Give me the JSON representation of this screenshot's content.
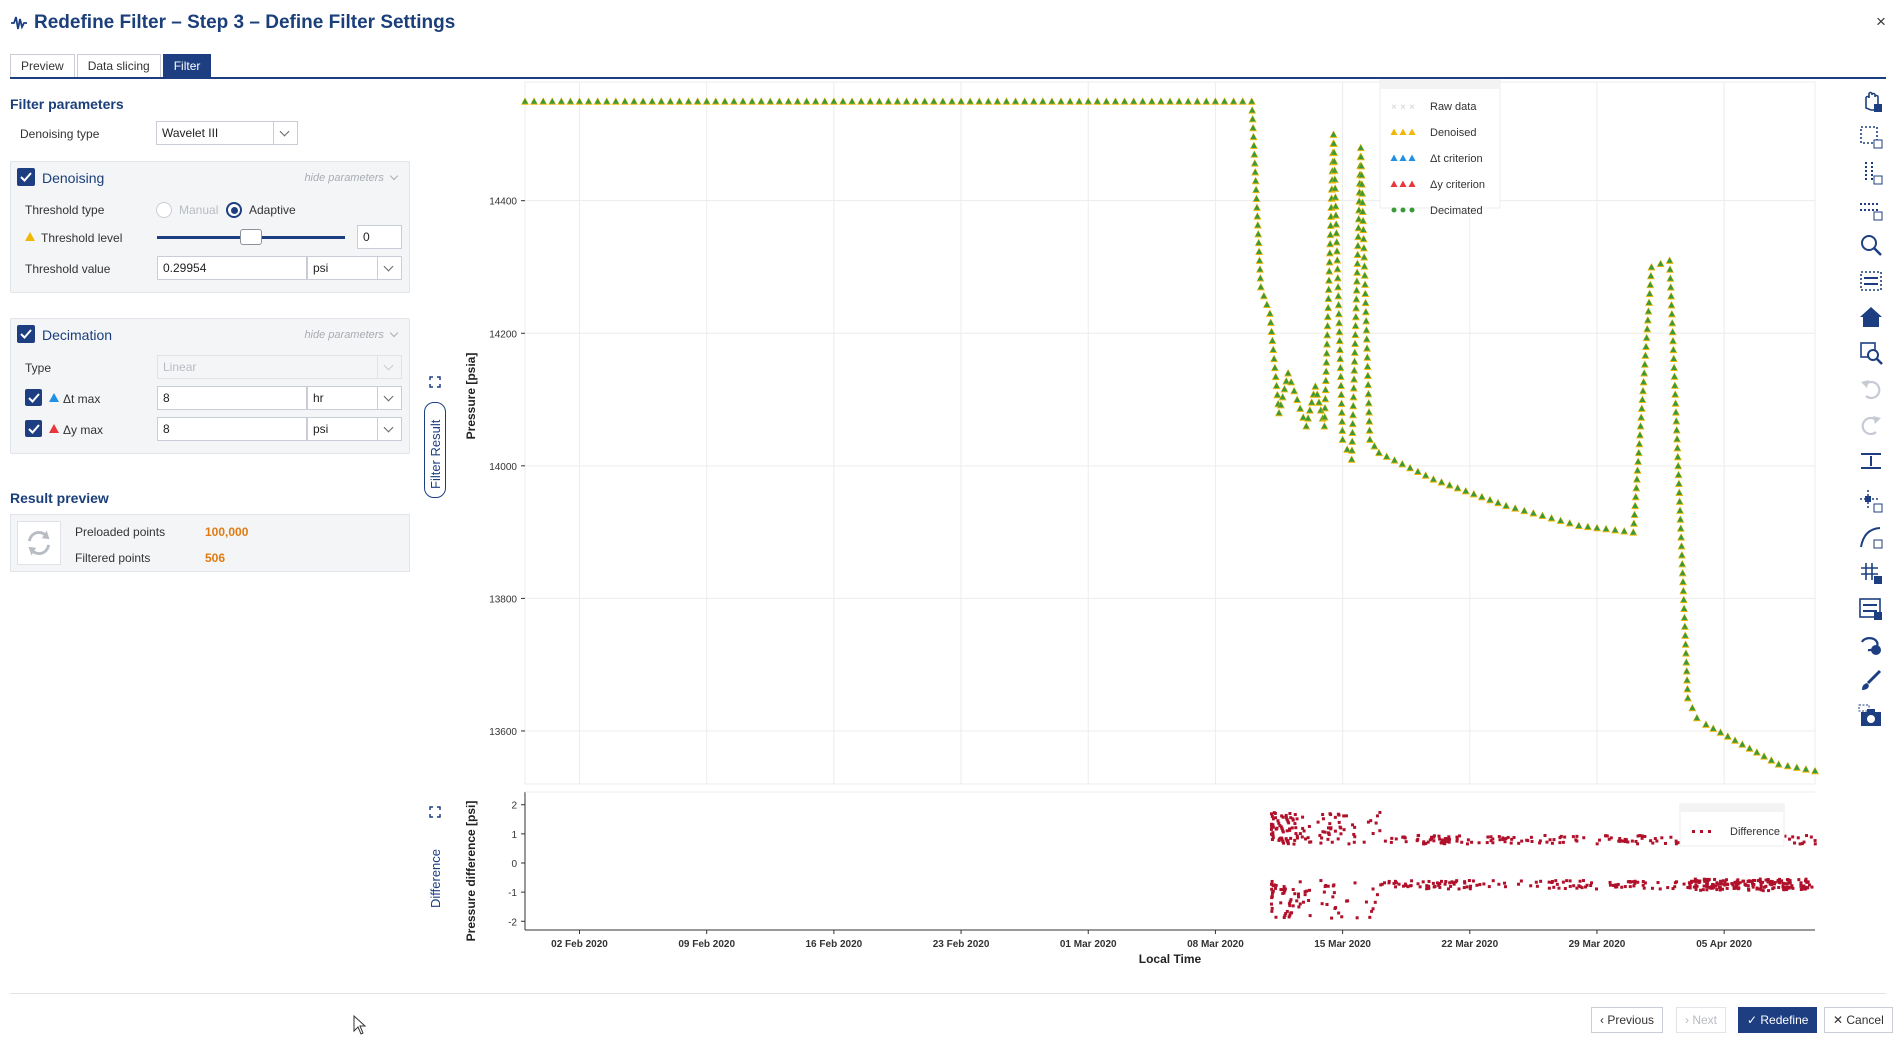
{
  "window": {
    "title": "Redefine Filter – Step 3 – Define Filter Settings",
    "close_label": "×"
  },
  "tabs": [
    {
      "label": "Preview",
      "active": false
    },
    {
      "label": "Data slicing",
      "active": false
    },
    {
      "label": "Filter",
      "active": true
    }
  ],
  "filter_params": {
    "title": "Filter parameters",
    "denoising_type_label": "Denoising type",
    "denoising_type_value": "Wavelet III"
  },
  "denoising": {
    "title": "Denoising",
    "checked": true,
    "hide_params": "hide parameters",
    "threshold_type_label": "Threshold type",
    "manual_label": "Manual",
    "adaptive_label": "Adaptive",
    "selected": "Adaptive",
    "threshold_level_label": "Threshold level",
    "threshold_level_value": "0",
    "threshold_level_position": 0.5,
    "threshold_value_label": "Threshold value",
    "threshold_value": "0.29954",
    "threshold_unit": "psi"
  },
  "decimation": {
    "title": "Decimation",
    "checked": true,
    "hide_params": "hide parameters",
    "type_label": "Type",
    "type_value": "Linear",
    "dt_label": "Δt max",
    "dt_value": "8",
    "dt_unit": "hr",
    "dy_label": "Δy max",
    "dy_value": "8",
    "dy_unit": "psi"
  },
  "result_preview": {
    "title": "Result preview",
    "preloaded_label": "Preloaded points",
    "preloaded_value": "100,000",
    "filtered_label": "Filtered points",
    "filtered_value": "506"
  },
  "colors": {
    "accent": "#1d3f82",
    "denoised": "#f2b705",
    "dt": "#1e90e8",
    "dy": "#e8373c",
    "decimated": "#3a9a3a",
    "difference": "#b0102a",
    "orange": "#e07b12"
  },
  "chart_panels": {
    "main_tab_label": "Filter Result",
    "diff_tab_label": "Difference"
  },
  "chart_data": [
    {
      "type": "scatter",
      "title": "",
      "ylabel": "Pressure [psia]",
      "xlabel": "Local Time",
      "x_ticks": [
        "02 Feb 2020",
        "09 Feb 2020",
        "16 Feb 2020",
        "23 Feb 2020",
        "01 Mar 2020",
        "08 Mar 2020",
        "15 Mar 2020",
        "22 Mar 2020",
        "29 Mar 2020",
        "05 Apr 2020"
      ],
      "y_ticks": [
        13600,
        13800,
        14000,
        14200,
        14400
      ],
      "ylim": [
        13520,
        14570
      ],
      "xlim": [
        "2020-01-30",
        "2020-04-10"
      ],
      "grid": true,
      "legend": [
        "Raw data",
        "Denoised",
        "Δt criterion",
        "Δy criterion",
        "Decimated"
      ],
      "legend_position": "top-right",
      "series": [
        {
          "name": "Decimated",
          "x": [
            "2020-01-30",
            "2020-02-05",
            "2020-02-12",
            "2020-02-19",
            "2020-02-26",
            "2020-03-04",
            "2020-03-10",
            "2020-03-10.5",
            "2020-03-11",
            "2020-03-11.5",
            "2020-03-12",
            "2020-03-13",
            "2020-03-13.5",
            "2020-03-14",
            "2020-03-14.5",
            "2020-03-15",
            "2020-03-15.5",
            "2020-03-16",
            "2020-03-16.5",
            "2020-03-17",
            "2020-03-20",
            "2020-03-24",
            "2020-03-28",
            "2020-03-31",
            "2020-04-01",
            "2020-04-02",
            "2020-04-03",
            "2020-04-03.5",
            "2020-04-04",
            "2020-04-06",
            "2020-04-08",
            "2020-04-10"
          ],
          "y": [
            14550,
            14550,
            14550,
            14550,
            14550,
            14550,
            14550,
            14270,
            14230,
            14080,
            14140,
            14060,
            14120,
            14060,
            14500,
            14040,
            14010,
            14480,
            14040,
            14020,
            13980,
            13940,
            13910,
            13900,
            14300,
            14310,
            13650,
            13620,
            13610,
            13580,
            13550,
            13540
          ]
        }
      ]
    },
    {
      "type": "scatter",
      "ylabel": "Pressure difference [psi]",
      "xlabel": "Local Time",
      "y_ticks": [
        -2,
        -1,
        0,
        1,
        2
      ],
      "ylim": [
        -2.3,
        2.3
      ],
      "legend": [
        "Difference"
      ],
      "legend_position": "top-right",
      "series": [
        {
          "name": "Difference",
          "x_range": [
            "2020-03-09",
            "2020-04-10"
          ],
          "bands": [
            [
              0.6,
              2.0
            ],
            [
              -2.2,
              -0.5
            ]
          ]
        }
      ]
    }
  ],
  "toolbar": {
    "tools": [
      "pan-icon",
      "box-select-icon",
      "y-select-icon",
      "x-select-icon",
      "zoom-icon",
      "box-zoom-icon",
      "home-icon",
      "zoom-region-icon",
      "undo-icon",
      "redo-icon",
      "crosshair-icon",
      "point-select-icon",
      "curve-icon",
      "grid-icon",
      "legend-icon",
      "lasso-icon",
      "brush-icon",
      "camera-icon"
    ]
  },
  "footer": {
    "previous": "Previous",
    "next": "Next",
    "redefine": "Redefine",
    "cancel": "Cancel"
  }
}
